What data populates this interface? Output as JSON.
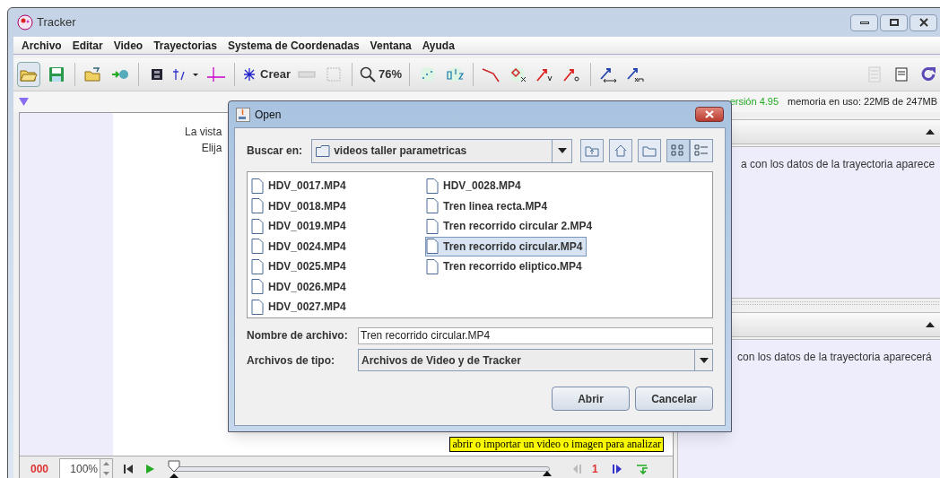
{
  "window": {
    "title": "Tracker"
  },
  "menu": [
    "Archivo",
    "Editar",
    "Video",
    "Trayectorias",
    "Systema de Coordenadas",
    "Ventana",
    "Ayuda"
  ],
  "toolbar": {
    "create_label": "Crear",
    "zoom": "76%"
  },
  "info_bar": {
    "version": "ersión 4.95",
    "memory": "memoria en uso: 22MB de 247MB"
  },
  "video_panel": {
    "lines": [
      "La vista",
      "Elija"
    ],
    "hint": "abrir o importar un video o imagen para analizar"
  },
  "player": {
    "frame": "000",
    "rate": "100%",
    "step": "1",
    "level": 0
  },
  "right_panels": [
    {
      "text": "a con los datos de la trayectoria aparece"
    },
    {
      "text": "con los datos de la trayectoria aparecerá"
    }
  ],
  "dialog": {
    "title": "Open",
    "look_in_label": "Buscar en:",
    "look_in": "videos taller parametricas",
    "files": [
      {
        "name": "HDV_0017.MP4",
        "selected": false
      },
      {
        "name": "HDV_0018.MP4",
        "selected": false
      },
      {
        "name": "HDV_0019.MP4",
        "selected": false
      },
      {
        "name": "HDV_0024.MP4",
        "selected": false
      },
      {
        "name": "HDV_0025.MP4",
        "selected": false
      },
      {
        "name": "HDV_0026.MP4",
        "selected": false
      },
      {
        "name": "HDV_0027.MP4",
        "selected": false
      },
      {
        "name": "HDV_0028.MP4",
        "selected": false
      },
      {
        "name": "Tren linea recta.MP4",
        "selected": false
      },
      {
        "name": "Tren recorrido circular 2.MP4",
        "selected": false
      },
      {
        "name": "Tren recorrido circular.MP4",
        "selected": true
      },
      {
        "name": "Tren recorrido eliptico.MP4",
        "selected": false
      }
    ],
    "file_name_label": "Nombre de archivo:",
    "file_name": "Tren recorrido circular.MP4",
    "file_type_label": "Archivos de tipo:",
    "file_type": "Archivos de Video y de Tracker",
    "buttons": [
      "Abrir",
      "Cancelar"
    ]
  }
}
